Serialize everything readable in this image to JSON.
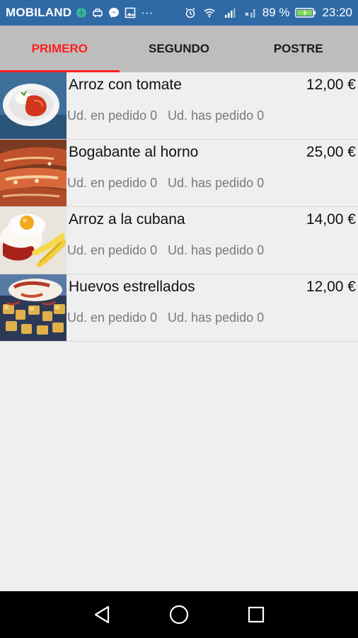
{
  "status_bar": {
    "carrier": "MOBILAND",
    "icons": [
      "globe-icon",
      "car-icon",
      "messenger-icon",
      "image-icon",
      "more-icon",
      "alarm-icon",
      "wifi-icon",
      "signal-icon",
      "signal-x-icon",
      "battery-charging-icon"
    ],
    "more_dots": "···",
    "battery": "89 %",
    "time": "23:20"
  },
  "tabs": [
    {
      "label": "PRIMERO",
      "active": true
    },
    {
      "label": "SEGUNDO",
      "active": false
    },
    {
      "label": "POSTRE",
      "active": false
    }
  ],
  "items": [
    {
      "name": "Arroz con tomate",
      "price": "12,00 €",
      "ordering": "Ud. en pedido 0",
      "ordered": "Ud. has pedido 0",
      "image": "rice-with-tomato-image"
    },
    {
      "name": "Bogabante al horno",
      "price": "25,00 €",
      "ordering": "Ud. en pedido 0",
      "ordered": "Ud. has pedido 0",
      "image": "baked-lobster-image"
    },
    {
      "name": "Arroz a la cubana",
      "price": "14,00 €",
      "ordering": "Ud. en pedido 0",
      "ordered": "Ud. has pedido 0",
      "image": "cuban-rice-image"
    },
    {
      "name": "Huevos estrellados",
      "price": "12,00 €",
      "ordering": "Ud. en pedido 0",
      "ordered": "Ud. has pedido 0",
      "image": "broken-eggs-image"
    }
  ],
  "nav": [
    "back-icon",
    "home-icon",
    "recents-icon"
  ],
  "colors": {
    "status_bar": "#2f6aa6",
    "tab_bar": "#bdbdbd",
    "active_tab": "#ff1f1f",
    "background": "#efefef"
  }
}
